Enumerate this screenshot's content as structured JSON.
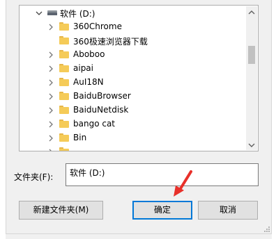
{
  "tree": {
    "drive": {
      "label": "软件 (D:)"
    },
    "items": [
      {
        "label": "360Chrome",
        "expandable": true
      },
      {
        "label": "360极速浏览器下载",
        "expandable": false
      },
      {
        "label": "Aboboo",
        "expandable": true
      },
      {
        "label": "aipai",
        "expandable": true
      },
      {
        "label": "AuI18N",
        "expandable": true
      },
      {
        "label": "BaiduBrowser",
        "expandable": true
      },
      {
        "label": "BaiduNetdisk",
        "expandable": true
      },
      {
        "label": "bango cat",
        "expandable": true
      },
      {
        "label": "Bin",
        "expandable": true
      }
    ]
  },
  "folder_field": {
    "label": "文件夹(F):",
    "value": "软件 (D:)"
  },
  "buttons": {
    "new_folder": "新建文件夹(M)",
    "ok": "确定",
    "cancel": "取消"
  },
  "colors": {
    "accent": "#0078d7",
    "pointer": "#e8302a",
    "folder": "#f5cb58"
  }
}
